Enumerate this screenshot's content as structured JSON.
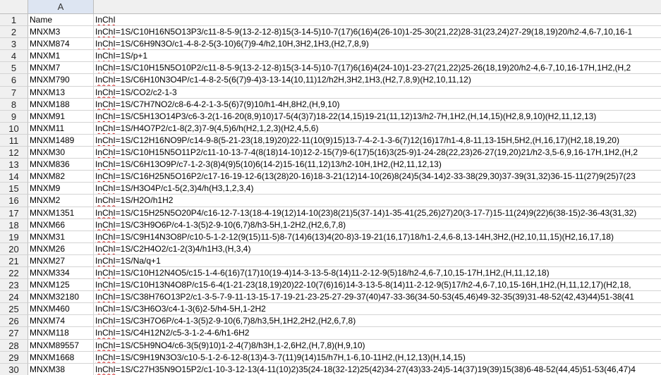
{
  "columns": [
    "A",
    ""
  ],
  "rows": [
    {
      "num": "1",
      "name": "Name",
      "inchi": "InChI"
    },
    {
      "num": "2",
      "name": "MNXM3",
      "inchi": "InChI=1S/C10H16N5O13P3/c11-8-5-9(13-2-12-8)15(3-14-5)10-7(17)6(16)4(26-10)1-25-30(21,22)28-31(23,24)27-29(18,19)20/h2-4,6-7,10,16-1"
    },
    {
      "num": "3",
      "name": "MNXM874",
      "inchi": "InChI=1S/C6H9N3O/c1-4-8-2-5(3-10)6(7)9-4/h2,10H,3H2,1H3,(H2,7,8,9)"
    },
    {
      "num": "4",
      "name": "MNXM1",
      "inchi": "InChI=1S/p+1"
    },
    {
      "num": "5",
      "name": "MNXM7",
      "inchi": "InChI=1S/C10H15N5O10P2/c11-8-5-9(13-2-12-8)15(3-14-5)10-7(17)6(16)4(24-10)1-23-27(21,22)25-26(18,19)20/h2-4,6-7,10,16-17H,1H2,(H,2"
    },
    {
      "num": "6",
      "name": "MNXM790",
      "inchi": "InChI=1S/C6H10N3O4P/c1-4-8-2-5(6(7)9-4)3-13-14(10,11)12/h2H,3H2,1H3,(H2,7,8,9)(H2,10,11,12)"
    },
    {
      "num": "7",
      "name": "MNXM13",
      "inchi": "InChI=1S/CO2/c2-1-3"
    },
    {
      "num": "8",
      "name": "MNXM188",
      "inchi": "InChI=1S/C7H7NO2/c8-6-4-2-1-3-5(6)7(9)10/h1-4H,8H2,(H,9,10)"
    },
    {
      "num": "9",
      "name": "MNXM91",
      "inchi": "InChI=1S/C5H13O14P3/c6-3-2(1-16-20(8,9)10)17-5(4(3)7)18-22(14,15)19-21(11,12)13/h2-7H,1H2,(H,14,15)(H2,8,9,10)(H2,11,12,13)"
    },
    {
      "num": "10",
      "name": "MNXM11",
      "inchi": "InChI=1S/H4O7P2/c1-8(2,3)7-9(4,5)6/h(H2,1,2,3)(H2,4,5,6)"
    },
    {
      "num": "11",
      "name": "MNXM1489",
      "inchi": "InChI=1S/C12H16NO9P/c14-9-8(5-21-23(18,19)20)22-11(10(9)15)13-7-4-2-1-3-6(7)12(16)17/h1-4,8-11,13-15H,5H2,(H,16,17)(H2,18,19,20)"
    },
    {
      "num": "12",
      "name": "MNXM30",
      "inchi": "InChI=1S/C10H15N5O11P2/c11-10-13-7-4(8(18)14-10)12-2-15(7)9-6(17)5(16)3(25-9)1-24-28(22,23)26-27(19,20)21/h2-3,5-6,9,16-17H,1H2,(H,2"
    },
    {
      "num": "13",
      "name": "MNXM836",
      "inchi": "InChI=1S/C6H13O9P/c7-1-2-3(8)4(9)5(10)6(14-2)15-16(11,12)13/h2-10H,1H2,(H2,11,12,13)"
    },
    {
      "num": "14",
      "name": "MNXM82",
      "inchi": "InChI=1S/C16H25N5O16P2/c17-16-19-12-6(13(28)20-16)18-3-21(12)14-10(26)8(24)5(34-14)2-33-38(29,30)37-39(31,32)36-15-11(27)9(25)7(23"
    },
    {
      "num": "15",
      "name": "MNXM9",
      "inchi": "InChI=1S/H3O4P/c1-5(2,3)4/h(H3,1,2,3,4)"
    },
    {
      "num": "16",
      "name": "MNXM2",
      "inchi": "InChI=1S/H2O/h1H2"
    },
    {
      "num": "17",
      "name": "MNXM1351",
      "inchi": "InChI=1S/C15H25N5O20P4/c16-12-7-13(18-4-19(12)14-10(23)8(21)5(37-14)1-35-41(25,26)27)20(3-17-7)15-11(24)9(22)6(38-15)2-36-43(31,32)"
    },
    {
      "num": "18",
      "name": "MNXM66",
      "inchi": "InChI=1S/C3H9O6P/c4-1-3(5)2-9-10(6,7)8/h3-5H,1-2H2,(H2,6,7,8)"
    },
    {
      "num": "19",
      "name": "MNXM31",
      "inchi": "InChI=1S/C9H14N3O8P/c10-5-1-2-12(9(15)11-5)8-7(14)6(13)4(20-8)3-19-21(16,17)18/h1-2,4,6-8,13-14H,3H2,(H2,10,11,15)(H2,16,17,18)"
    },
    {
      "num": "20",
      "name": "MNXM26",
      "inchi": "InChI=1S/C2H4O2/c1-2(3)4/h1H3,(H,3,4)"
    },
    {
      "num": "21",
      "name": "MNXM27",
      "inchi": "InChI=1S/Na/q+1"
    },
    {
      "num": "22",
      "name": "MNXM334",
      "inchi": "InChI=1S/C10H12N4O5/c15-1-4-6(16)7(17)10(19-4)14-3-13-5-8(14)11-2-12-9(5)18/h2-4,6-7,10,15-17H,1H2,(H,11,12,18)"
    },
    {
      "num": "23",
      "name": "MNXM125",
      "inchi": "InChI=1S/C10H13N4O8P/c15-6-4(1-21-23(18,19)20)22-10(7(6)16)14-3-13-5-8(14)11-2-12-9(5)17/h2-4,6-7,10,15-16H,1H2,(H,11,12,17)(H2,18,"
    },
    {
      "num": "24",
      "name": "MNXM32180",
      "inchi": "InChI=1S/C38H76O13P2/c1-3-5-7-9-11-13-15-17-19-21-23-25-27-29-37(40)47-33-36(34-50-53(45,46)49-32-35(39)31-48-52(42,43)44)51-38(41"
    },
    {
      "num": "25",
      "name": "MNXM460",
      "inchi": "InChI=1S/C3H6O3/c4-1-3(6)2-5/h4-5H,1-2H2"
    },
    {
      "num": "26",
      "name": "MNXM74",
      "inchi": "InChI=1S/C3H7O6P/c4-1-3(5)2-9-10(6,7)8/h3,5H,1H2,2H2,(H2,6,7,8)"
    },
    {
      "num": "27",
      "name": "MNXM118",
      "inchi": "InChI=1S/C4H12N2/c5-3-1-2-4-6/h1-6H2"
    },
    {
      "num": "28",
      "name": "MNXM89557",
      "inchi": "InChI=1S/C5H9NO4/c6-3(5(9)10)1-2-4(7)8/h3H,1-2,6H2,(H,7,8)(H,9,10)"
    },
    {
      "num": "29",
      "name": "MNXM1668",
      "inchi": "InChI=1S/C9H19N3O3/c10-5-1-2-6-12-8(13)4-3-7(11)9(14)15/h7H,1-6,10-11H2,(H,12,13)(H,14,15)"
    },
    {
      "num": "30",
      "name": "MNXM38",
      "inchi": "InChI=1S/C27H35N9O15P2/c1-10-3-12-13(4-11(10)2)35(24-18(32-12)25(42)34-27(43)33-24)5-14(37)19(39)15(38)6-48-52(44,45)51-53(46,47)4"
    }
  ]
}
